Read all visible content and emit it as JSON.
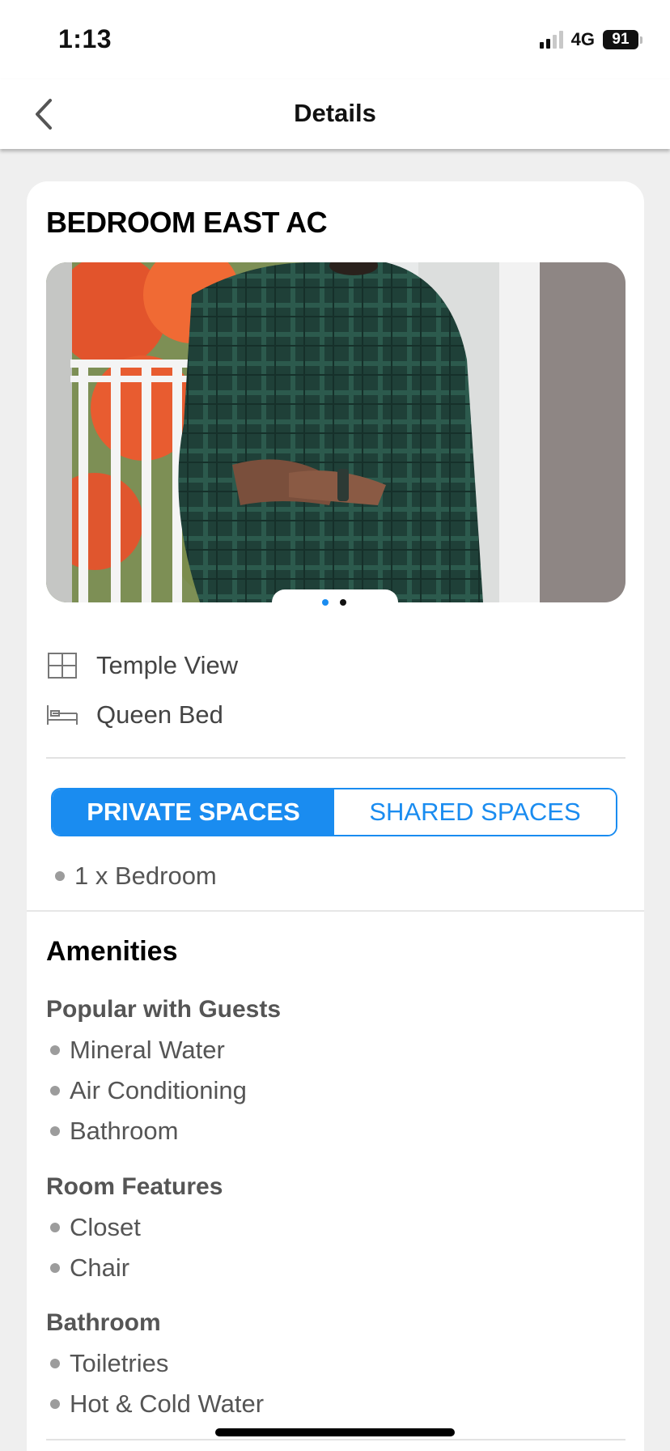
{
  "status_bar": {
    "time": "1:13",
    "network": "4G",
    "battery": "91"
  },
  "nav": {
    "title": "Details",
    "back_icon": "chevron-left-icon"
  },
  "room": {
    "title": "BEDROOM EAST AC",
    "photo_description": "",
    "carousel": {
      "total": 2,
      "active_index": 0
    }
  },
  "features": [
    {
      "icon": "window-icon",
      "label": "Temple View"
    },
    {
      "icon": "bed-icon",
      "label": "Queen Bed"
    }
  ],
  "spaces": {
    "tabs": [
      {
        "label": "PRIVATE SPACES",
        "active": true
      },
      {
        "label": "SHARED SPACES",
        "active": false
      }
    ],
    "items": [
      "1 x Bedroom"
    ]
  },
  "amenities": {
    "title": "Amenities",
    "groups": [
      {
        "title": "Popular with Guests",
        "items": [
          "Mineral Water",
          "Air Conditioning",
          "Bathroom"
        ]
      },
      {
        "title": "Room Features",
        "items": [
          "Closet",
          "Chair"
        ]
      },
      {
        "title": "Bathroom",
        "items": [
          "Toiletries",
          "Hot & Cold Water"
        ]
      }
    ]
  },
  "colors": {
    "accent": "#1a8cf0",
    "background": "#efefef"
  }
}
